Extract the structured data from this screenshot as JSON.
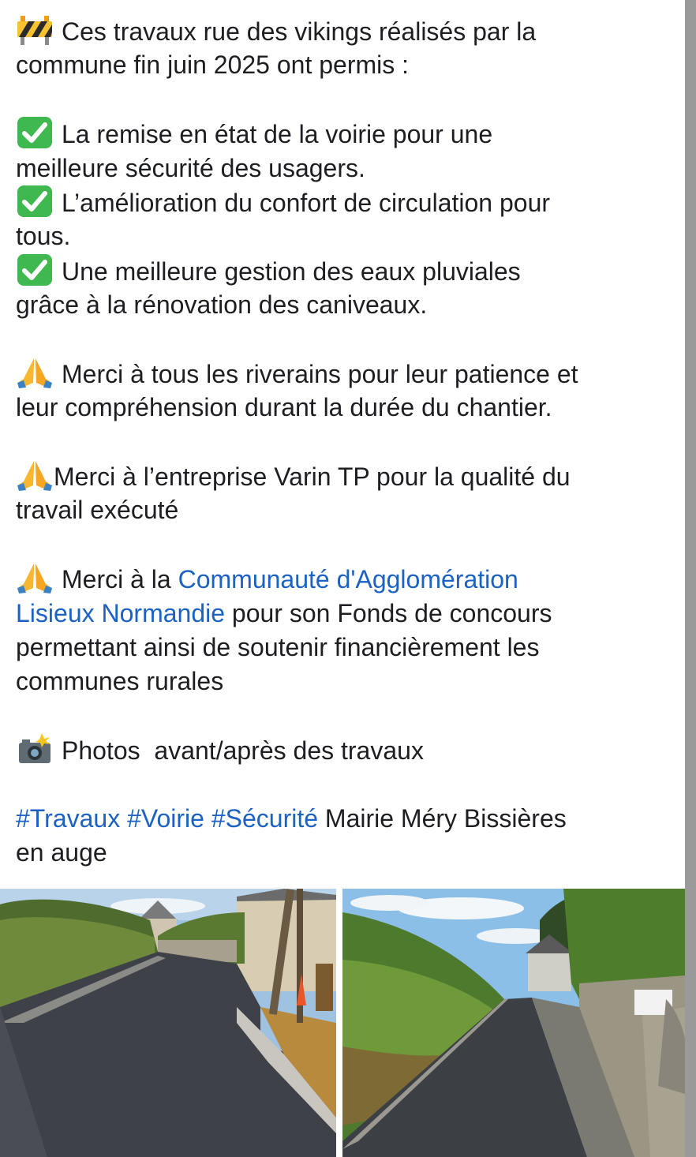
{
  "post": {
    "intro": {
      "icon": "construction-icon",
      "line1": "Ces travaux rue des vikings réalisés par la",
      "line2": "commune fin juin 2025 ont permis :"
    },
    "benefits": [
      {
        "icon": "check-mark-button-icon",
        "line1": "La remise en état de la voirie pour une",
        "line2": "meilleure sécurité des usagers."
      },
      {
        "icon": "check-mark-button-icon",
        "line1": "L’amélioration du confort de circulation pour",
        "line2": "tous."
      },
      {
        "icon": "check-mark-button-icon",
        "line1": "Une meilleure gestion des eaux pluviales",
        "line2": "grâce à la rénovation des caniveaux."
      }
    ],
    "thanks_residents": {
      "icon": "folded-hands-icon",
      "line1": "Merci à tous les riverains pour leur patience et",
      "line2": "leur compréhension durant la durée du chantier."
    },
    "thanks_company": {
      "icon": "folded-hands-icon",
      "line1": "Merci à l’entreprise Varin TP pour la qualité du",
      "line2": "travail exécuté"
    },
    "thanks_agglo": {
      "icon": "folded-hands-icon",
      "prefix": "Merci à la ",
      "link_part1": "Communauté d'Agglomération",
      "link_part2": "Lisieux Normandie",
      "rest_line2": " pour son Fonds de concours",
      "line3": "permettant ainsi de soutenir financièrement les",
      "line4": "communes rurales"
    },
    "photos_caption": {
      "icon": "camera-flash-icon",
      "text": "Photos  avant/après des travaux"
    },
    "hashtags": [
      "#Travaux",
      "#Voirie",
      "#Sécurité"
    ],
    "mention_line1": "Mairie Méry Bissières",
    "mention_line2": "en auge"
  },
  "colors": {
    "link": "#1b62c4",
    "text": "#1c1e21",
    "scrollbar": "#9a9a9a"
  }
}
